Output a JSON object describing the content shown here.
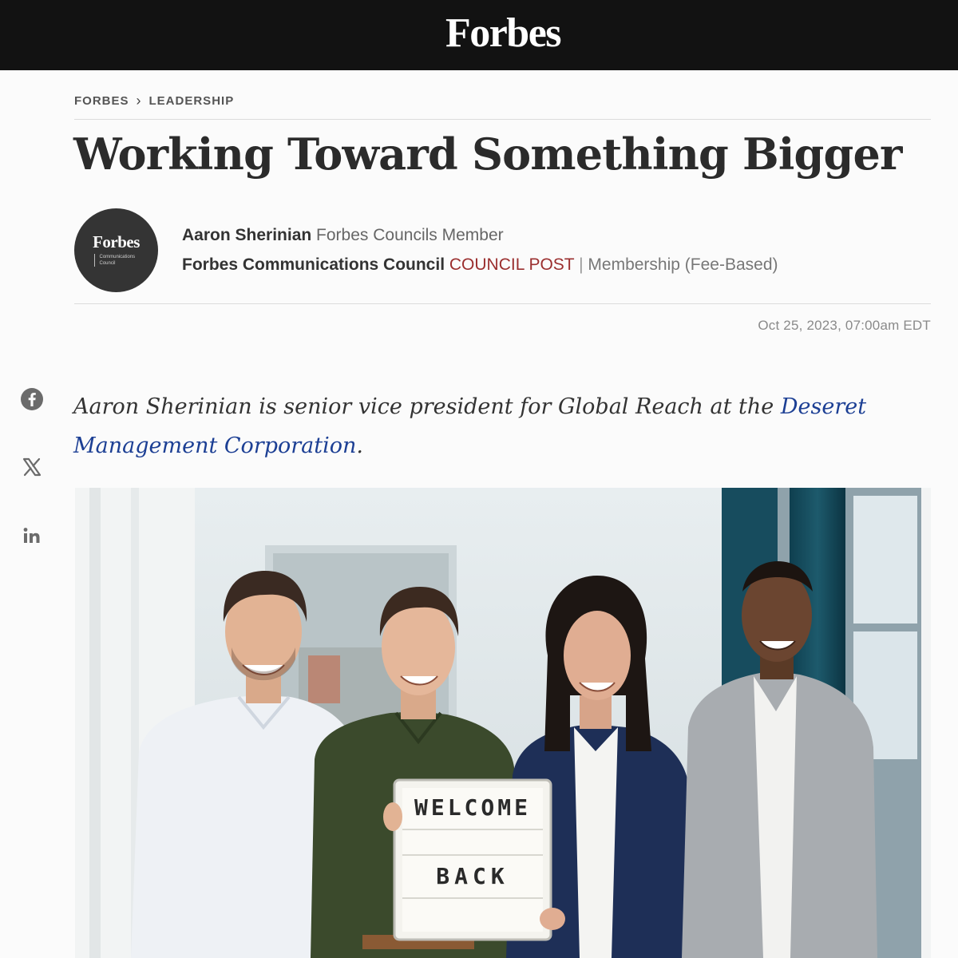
{
  "header": {
    "brand": "Forbes"
  },
  "breadcrumb": {
    "items": [
      "FORBES",
      "LEADERSHIP"
    ],
    "separator": "›"
  },
  "article": {
    "title": "Working Toward Something Bigger",
    "author": {
      "name": "Aaron Sherinian",
      "role": "Forbes Councils Member",
      "avatar_logo": "Forbes",
      "avatar_subtext": "Communications Council"
    },
    "council": {
      "name": "Forbes Communications Council",
      "post_label": "COUNCIL POST",
      "divider": "|",
      "membership": "Membership (Fee-Based)"
    },
    "date": "Oct 25, 2023, 07:00am EDT",
    "dek": {
      "text_before_link": "Aaron Sherinian is senior vice president for Global Reach at the ",
      "link_text": "Deseret Management Corporation",
      "text_after_link": "."
    },
    "hero_image": {
      "sign_line_1": "WELCOME",
      "sign_line_2": "BACK"
    }
  },
  "share": {
    "icons": [
      "facebook-icon",
      "x-icon",
      "linkedin-icon"
    ]
  },
  "colors": {
    "topbar": "#121212",
    "council_post": "#9b2f2f",
    "link": "#1c3f94"
  }
}
